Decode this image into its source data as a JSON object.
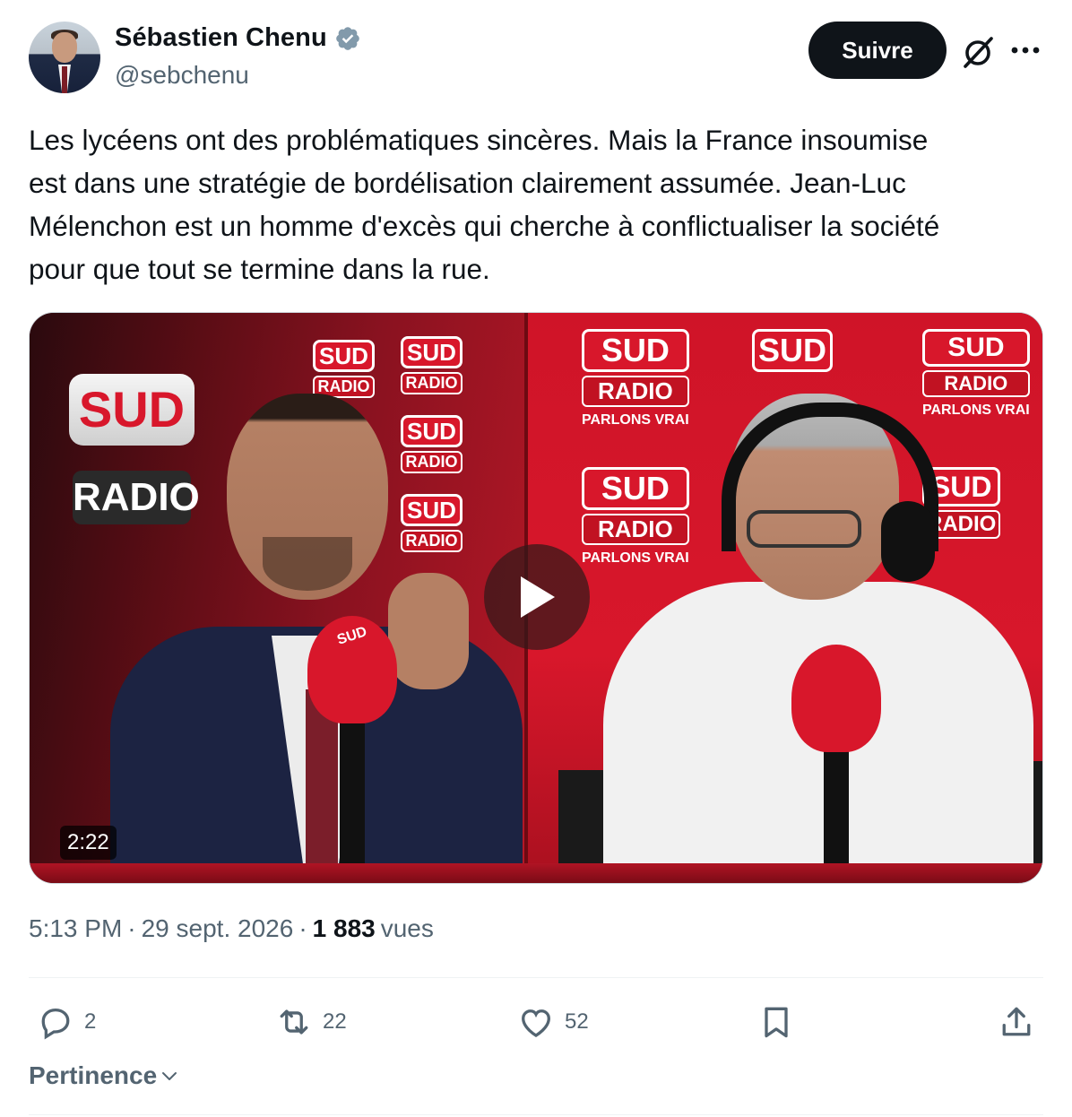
{
  "author": {
    "name": "Sébastien Chenu",
    "handle": "@sebchenu",
    "verified_color": "#829aab"
  },
  "header": {
    "follow_label": "Suivre",
    "grok_icon": "grok-slash-icon",
    "more_icon": "more-dots-icon"
  },
  "tweet": {
    "text": "Les lycéens ont des problématiques sincères. Mais la France insoumise\nest dans une stratégie de bordélisation clairement assumée. Jean-Luc\nMélenchon est un homme d'excès qui cherche à conflictualiser la société\npour que tout se termine dans la rue."
  },
  "video": {
    "duration": "2:22",
    "logo_sud": "SUD",
    "logo_radio": "RADIO",
    "slogan": "PARLONS VRAI"
  },
  "meta": {
    "time": "5:13 PM",
    "separator": "·",
    "date": "29 sept. 2026",
    "views_count": "1 883",
    "views_label": "vues"
  },
  "actions": {
    "replies": "2",
    "reposts": "22",
    "likes": "52"
  },
  "sort": {
    "label": "Pertinence"
  },
  "colors": {
    "text": "#0f1419",
    "muted": "#536471",
    "follow_bg": "#0f1419",
    "brand_red": "#d8172b"
  }
}
